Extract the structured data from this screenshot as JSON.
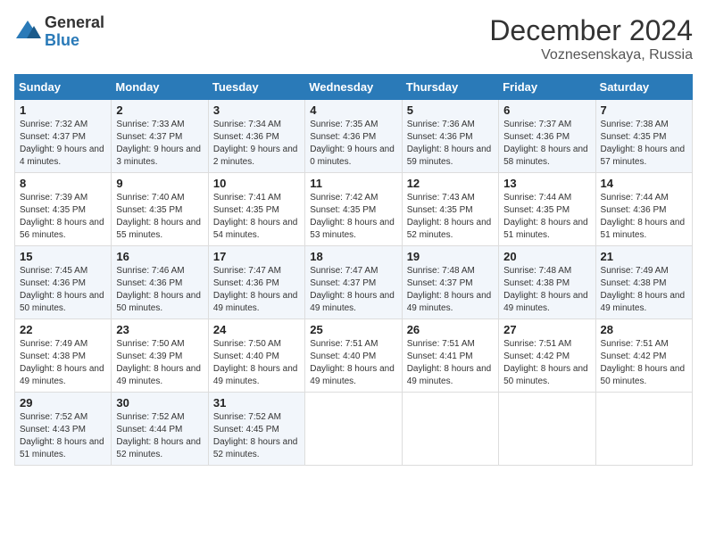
{
  "header": {
    "logo_general": "General",
    "logo_blue": "Blue",
    "title": "December 2024",
    "subtitle": "Voznesenskaya, Russia"
  },
  "calendar": {
    "days_of_week": [
      "Sunday",
      "Monday",
      "Tuesday",
      "Wednesday",
      "Thursday",
      "Friday",
      "Saturday"
    ],
    "weeks": [
      [
        {
          "day": "1",
          "sunrise": "Sunrise: 7:32 AM",
          "sunset": "Sunset: 4:37 PM",
          "daylight": "Daylight: 9 hours and 4 minutes."
        },
        {
          "day": "2",
          "sunrise": "Sunrise: 7:33 AM",
          "sunset": "Sunset: 4:37 PM",
          "daylight": "Daylight: 9 hours and 3 minutes."
        },
        {
          "day": "3",
          "sunrise": "Sunrise: 7:34 AM",
          "sunset": "Sunset: 4:36 PM",
          "daylight": "Daylight: 9 hours and 2 minutes."
        },
        {
          "day": "4",
          "sunrise": "Sunrise: 7:35 AM",
          "sunset": "Sunset: 4:36 PM",
          "daylight": "Daylight: 9 hours and 0 minutes."
        },
        {
          "day": "5",
          "sunrise": "Sunrise: 7:36 AM",
          "sunset": "Sunset: 4:36 PM",
          "daylight": "Daylight: 8 hours and 59 minutes."
        },
        {
          "day": "6",
          "sunrise": "Sunrise: 7:37 AM",
          "sunset": "Sunset: 4:36 PM",
          "daylight": "Daylight: 8 hours and 58 minutes."
        },
        {
          "day": "7",
          "sunrise": "Sunrise: 7:38 AM",
          "sunset": "Sunset: 4:35 PM",
          "daylight": "Daylight: 8 hours and 57 minutes."
        }
      ],
      [
        {
          "day": "8",
          "sunrise": "Sunrise: 7:39 AM",
          "sunset": "Sunset: 4:35 PM",
          "daylight": "Daylight: 8 hours and 56 minutes."
        },
        {
          "day": "9",
          "sunrise": "Sunrise: 7:40 AM",
          "sunset": "Sunset: 4:35 PM",
          "daylight": "Daylight: 8 hours and 55 minutes."
        },
        {
          "day": "10",
          "sunrise": "Sunrise: 7:41 AM",
          "sunset": "Sunset: 4:35 PM",
          "daylight": "Daylight: 8 hours and 54 minutes."
        },
        {
          "day": "11",
          "sunrise": "Sunrise: 7:42 AM",
          "sunset": "Sunset: 4:35 PM",
          "daylight": "Daylight: 8 hours and 53 minutes."
        },
        {
          "day": "12",
          "sunrise": "Sunrise: 7:43 AM",
          "sunset": "Sunset: 4:35 PM",
          "daylight": "Daylight: 8 hours and 52 minutes."
        },
        {
          "day": "13",
          "sunrise": "Sunrise: 7:44 AM",
          "sunset": "Sunset: 4:35 PM",
          "daylight": "Daylight: 8 hours and 51 minutes."
        },
        {
          "day": "14",
          "sunrise": "Sunrise: 7:44 AM",
          "sunset": "Sunset: 4:36 PM",
          "daylight": "Daylight: 8 hours and 51 minutes."
        }
      ],
      [
        {
          "day": "15",
          "sunrise": "Sunrise: 7:45 AM",
          "sunset": "Sunset: 4:36 PM",
          "daylight": "Daylight: 8 hours and 50 minutes."
        },
        {
          "day": "16",
          "sunrise": "Sunrise: 7:46 AM",
          "sunset": "Sunset: 4:36 PM",
          "daylight": "Daylight: 8 hours and 50 minutes."
        },
        {
          "day": "17",
          "sunrise": "Sunrise: 7:47 AM",
          "sunset": "Sunset: 4:36 PM",
          "daylight": "Daylight: 8 hours and 49 minutes."
        },
        {
          "day": "18",
          "sunrise": "Sunrise: 7:47 AM",
          "sunset": "Sunset: 4:37 PM",
          "daylight": "Daylight: 8 hours and 49 minutes."
        },
        {
          "day": "19",
          "sunrise": "Sunrise: 7:48 AM",
          "sunset": "Sunset: 4:37 PM",
          "daylight": "Daylight: 8 hours and 49 minutes."
        },
        {
          "day": "20",
          "sunrise": "Sunrise: 7:48 AM",
          "sunset": "Sunset: 4:38 PM",
          "daylight": "Daylight: 8 hours and 49 minutes."
        },
        {
          "day": "21",
          "sunrise": "Sunrise: 7:49 AM",
          "sunset": "Sunset: 4:38 PM",
          "daylight": "Daylight: 8 hours and 49 minutes."
        }
      ],
      [
        {
          "day": "22",
          "sunrise": "Sunrise: 7:49 AM",
          "sunset": "Sunset: 4:38 PM",
          "daylight": "Daylight: 8 hours and 49 minutes."
        },
        {
          "day": "23",
          "sunrise": "Sunrise: 7:50 AM",
          "sunset": "Sunset: 4:39 PM",
          "daylight": "Daylight: 8 hours and 49 minutes."
        },
        {
          "day": "24",
          "sunrise": "Sunrise: 7:50 AM",
          "sunset": "Sunset: 4:40 PM",
          "daylight": "Daylight: 8 hours and 49 minutes."
        },
        {
          "day": "25",
          "sunrise": "Sunrise: 7:51 AM",
          "sunset": "Sunset: 4:40 PM",
          "daylight": "Daylight: 8 hours and 49 minutes."
        },
        {
          "day": "26",
          "sunrise": "Sunrise: 7:51 AM",
          "sunset": "Sunset: 4:41 PM",
          "daylight": "Daylight: 8 hours and 49 minutes."
        },
        {
          "day": "27",
          "sunrise": "Sunrise: 7:51 AM",
          "sunset": "Sunset: 4:42 PM",
          "daylight": "Daylight: 8 hours and 50 minutes."
        },
        {
          "day": "28",
          "sunrise": "Sunrise: 7:51 AM",
          "sunset": "Sunset: 4:42 PM",
          "daylight": "Daylight: 8 hours and 50 minutes."
        }
      ],
      [
        {
          "day": "29",
          "sunrise": "Sunrise: 7:52 AM",
          "sunset": "Sunset: 4:43 PM",
          "daylight": "Daylight: 8 hours and 51 minutes."
        },
        {
          "day": "30",
          "sunrise": "Sunrise: 7:52 AM",
          "sunset": "Sunset: 4:44 PM",
          "daylight": "Daylight: 8 hours and 52 minutes."
        },
        {
          "day": "31",
          "sunrise": "Sunrise: 7:52 AM",
          "sunset": "Sunset: 4:45 PM",
          "daylight": "Daylight: 8 hours and 52 minutes."
        },
        null,
        null,
        null,
        null
      ]
    ]
  }
}
